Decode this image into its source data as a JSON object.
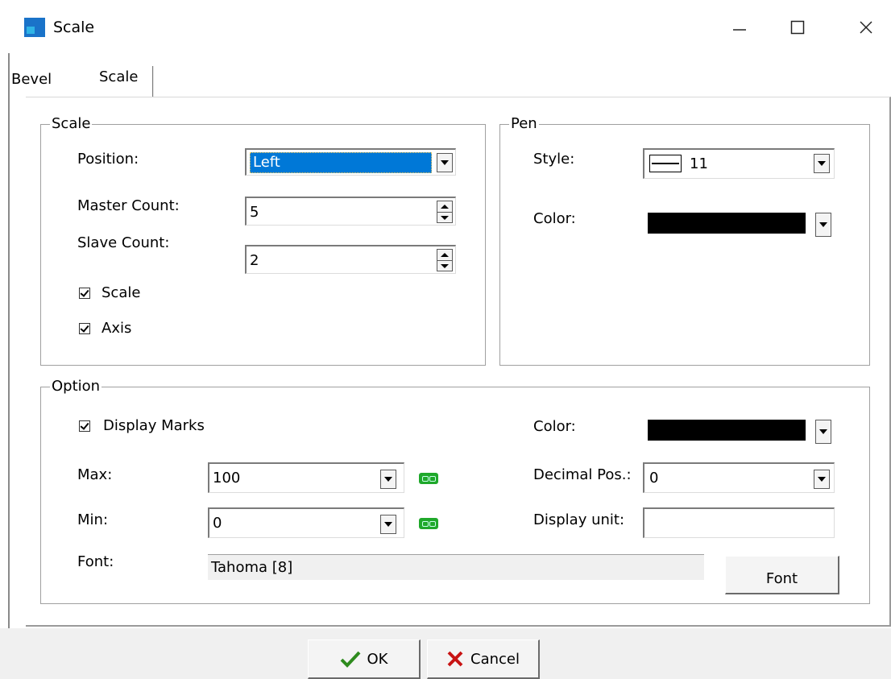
{
  "window": {
    "title": "Scale",
    "icon": "app-icon",
    "controls": [
      "minimize-icon",
      "maximize-icon",
      "close-icon"
    ]
  },
  "tabs": [
    {
      "label": "Bevel",
      "selected": false
    },
    {
      "label": "Scale",
      "selected": true
    }
  ],
  "scale_group": {
    "title": "Scale",
    "position_label": "Position:",
    "position_value": "Left",
    "master_count_label": "Master Count:",
    "master_count_value": "5",
    "slave_count_label": "Slave Count:",
    "slave_count_value": "2",
    "scale_checkbox_label": "Scale",
    "scale_checked": true,
    "axis_checkbox_label": "Axis",
    "axis_checked": true
  },
  "pen_group": {
    "title": "Pen",
    "style_label": "Style:",
    "style_value": "11",
    "color_label": "Color:",
    "color_value": "#000000"
  },
  "option_group": {
    "title": "Option",
    "display_marks_label": "Display Marks",
    "display_marks_checked": true,
    "max_label": "Max:",
    "max_value": "100",
    "min_label": "Min:",
    "min_value": "0",
    "font_label": "Font:",
    "font_value": "Tahoma [8]",
    "color_label": "Color:",
    "color_value": "#000000",
    "decimal_pos_label": "Decimal Pos.:",
    "decimal_pos_value": "0",
    "display_unit_label": "Display unit:",
    "display_unit_value": "",
    "font_button_label": "Font"
  },
  "footer": {
    "ok_label": "OK",
    "cancel_label": "Cancel"
  },
  "colors": {
    "selection": "#0078d7",
    "check_green": "#2e8b1e",
    "cancel_red": "#c81414",
    "chain_green": "#1fa82a"
  }
}
